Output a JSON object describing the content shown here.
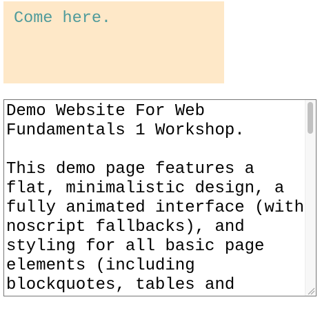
{
  "hover_box": {
    "text": "Come here.",
    "background": "#fee8c8",
    "text_color": "#4f9b9b"
  },
  "textarea": {
    "value": "Demo Website For Web Fundamentals 1 Workshop.\n\nThis demo page features a flat, minimalistic design, a fully animated interface (with noscript fallbacks), and styling for all basic page elements (including blockquotes, tables and",
    "scroll_position": 0
  }
}
